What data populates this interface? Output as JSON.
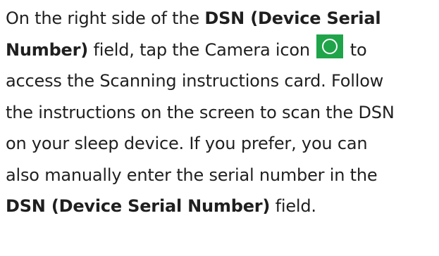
{
  "instruction": {
    "l1_pre": "On the right side of the ",
    "l1_bold": "DSN (Device Serial",
    "l2_bold": "Number)",
    "l2_mid": " field, tap the Camera icon ",
    "l2_post": " to",
    "l3": "access the Scanning instructions card. Follow",
    "l4": "the instructions on the screen to scan the DSN",
    "l5": "on your sleep device. If you prefer, you can",
    "l6": "also manually enter the serial number in the",
    "l7_bold": "DSN (Device Serial Number)",
    "l7_post": " field."
  },
  "camera_icon": {
    "name": "camera-icon",
    "color": "#1fa44a"
  }
}
